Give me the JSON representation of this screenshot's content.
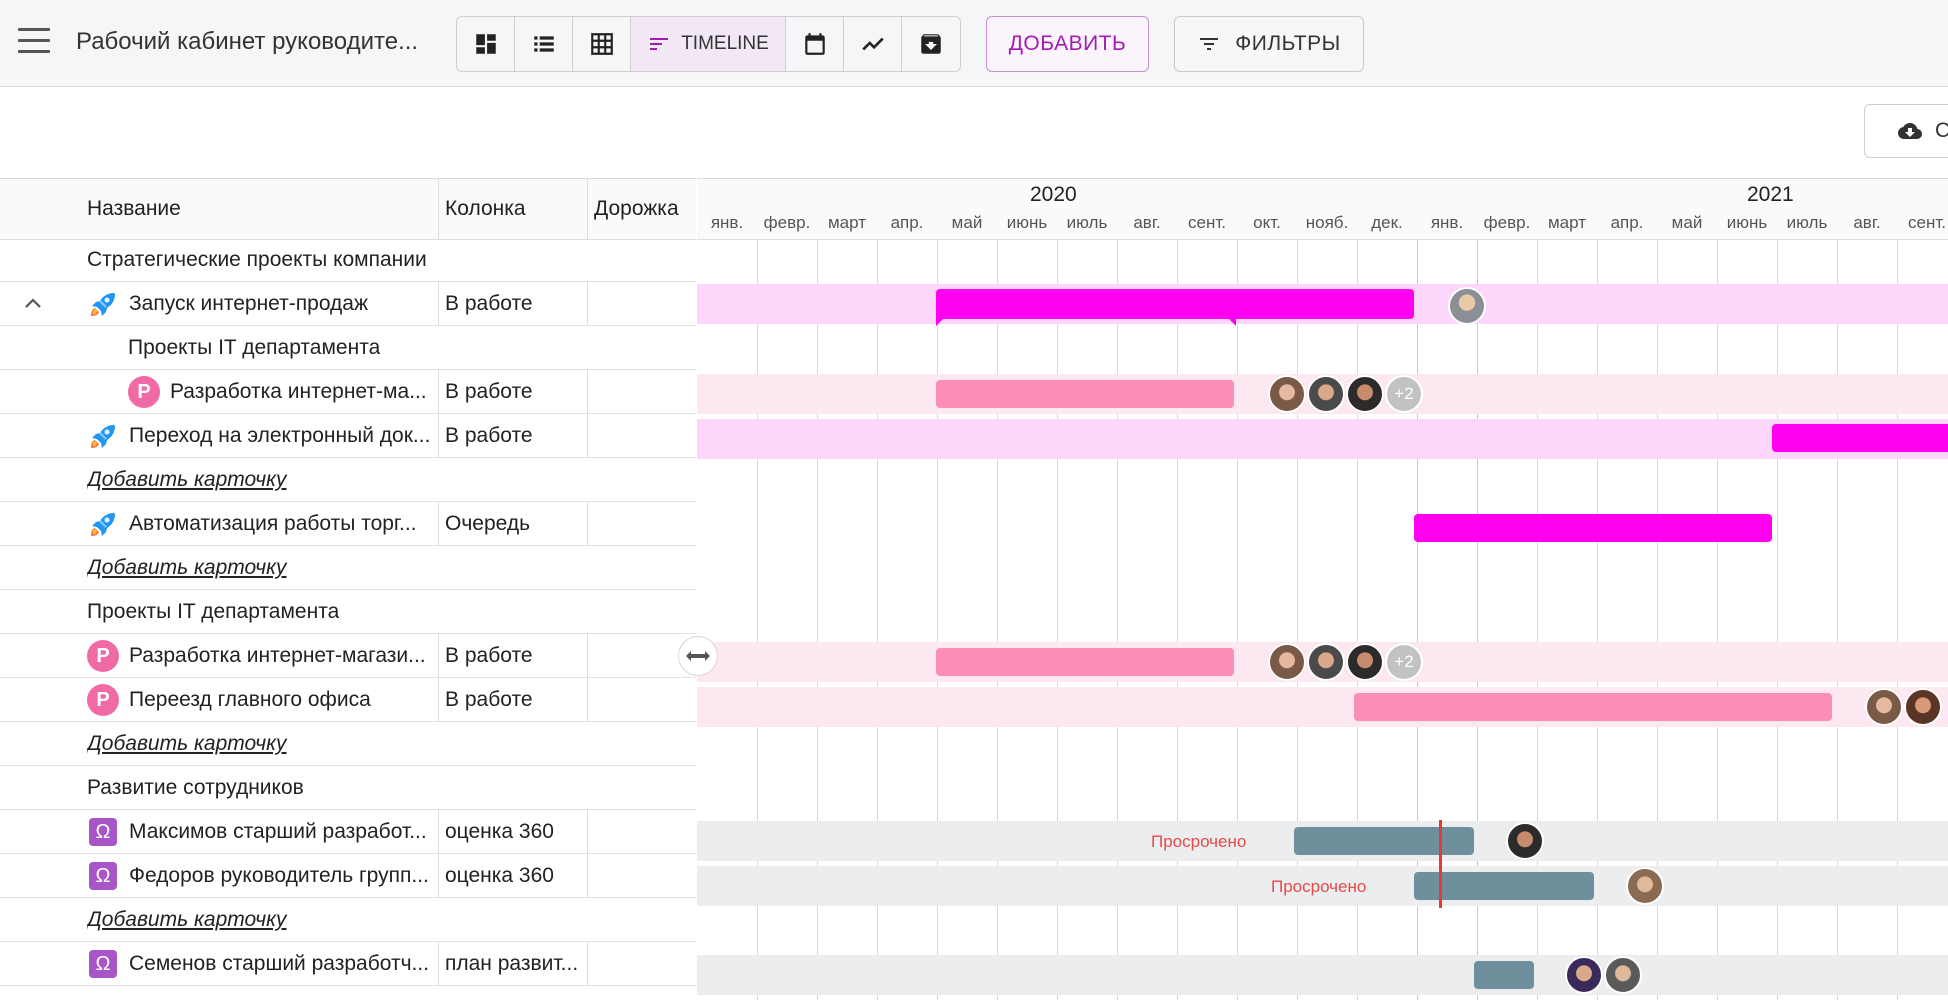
{
  "header": {
    "board_title": "Рабочий кабинет руководите...",
    "views": [
      {
        "name": "dashboard-view-icon"
      },
      {
        "name": "list-view-icon"
      },
      {
        "name": "table-view-icon"
      },
      {
        "name": "timeline-view-icon",
        "label": "TIMELINE",
        "active": true
      },
      {
        "name": "calendar-view-icon"
      },
      {
        "name": "chart-view-icon"
      },
      {
        "name": "archive-view-icon"
      }
    ],
    "add_label": "ДОБАВИТЬ",
    "filters_label": "ФИЛЬТРЫ",
    "export_label": "С"
  },
  "table": {
    "headers": {
      "name": "Название",
      "column": "Колонка",
      "lane": "Дорожка"
    },
    "rows": [
      {
        "type": "group",
        "title": "Стратегические проекты компании"
      },
      {
        "type": "card",
        "icon": "rocket",
        "name": "Запуск интернет-продаж",
        "column": "В работе",
        "expander": true
      },
      {
        "type": "subgroup",
        "title": "Проекты IT департамента"
      },
      {
        "type": "card",
        "icon": "p",
        "indent": true,
        "name": "Разработка интернет-ма...",
        "column": "В работе"
      },
      {
        "type": "card",
        "icon": "rocket",
        "name": "Переход на электронный док...",
        "column": "В работе"
      },
      {
        "type": "add",
        "label": "Добавить карточку"
      },
      {
        "type": "card",
        "icon": "rocket",
        "name": "Автоматизация работы торг...",
        "column": "Очередь"
      },
      {
        "type": "add",
        "label": "Добавить карточку"
      },
      {
        "type": "group",
        "title": "Проекты IT департамента"
      },
      {
        "type": "card",
        "icon": "p",
        "name": "Разработка интернет-магази...",
        "column": "В работе"
      },
      {
        "type": "card",
        "icon": "p",
        "name": "Переезд главного офиса",
        "column": "В работе"
      },
      {
        "type": "add",
        "label": "Добавить карточку"
      },
      {
        "type": "group",
        "title": "Развитие сотрудников"
      },
      {
        "type": "card",
        "icon": "omega",
        "name": "Максимов старший разработ...",
        "column": "оценка 360"
      },
      {
        "type": "card",
        "icon": "omega",
        "name": "Федоров руководитель групп...",
        "column": "оценка 360"
      },
      {
        "type": "add",
        "label": "Добавить карточку"
      },
      {
        "type": "card",
        "icon": "omega",
        "name": "Семенов старший разработч...",
        "column": "план развит..."
      }
    ]
  },
  "timeline": {
    "years": [
      "2020",
      "2021"
    ],
    "months": [
      "янв.",
      "февр.",
      "март",
      "апр.",
      "май",
      "июнь",
      "июль",
      "авг.",
      "сент.",
      "окт.",
      "нояб.",
      "дек.",
      "янв.",
      "февр.",
      "март",
      "апр.",
      "май",
      "июнь",
      "июль",
      "авг.",
      "сент."
    ],
    "overdue_label": "Просрочено",
    "extra_assignees": "+2",
    "colors": {
      "magenta": "#ff00f0",
      "pink": "#fb8db6",
      "slate": "#6e8f9c",
      "red": "#e53935"
    }
  }
}
